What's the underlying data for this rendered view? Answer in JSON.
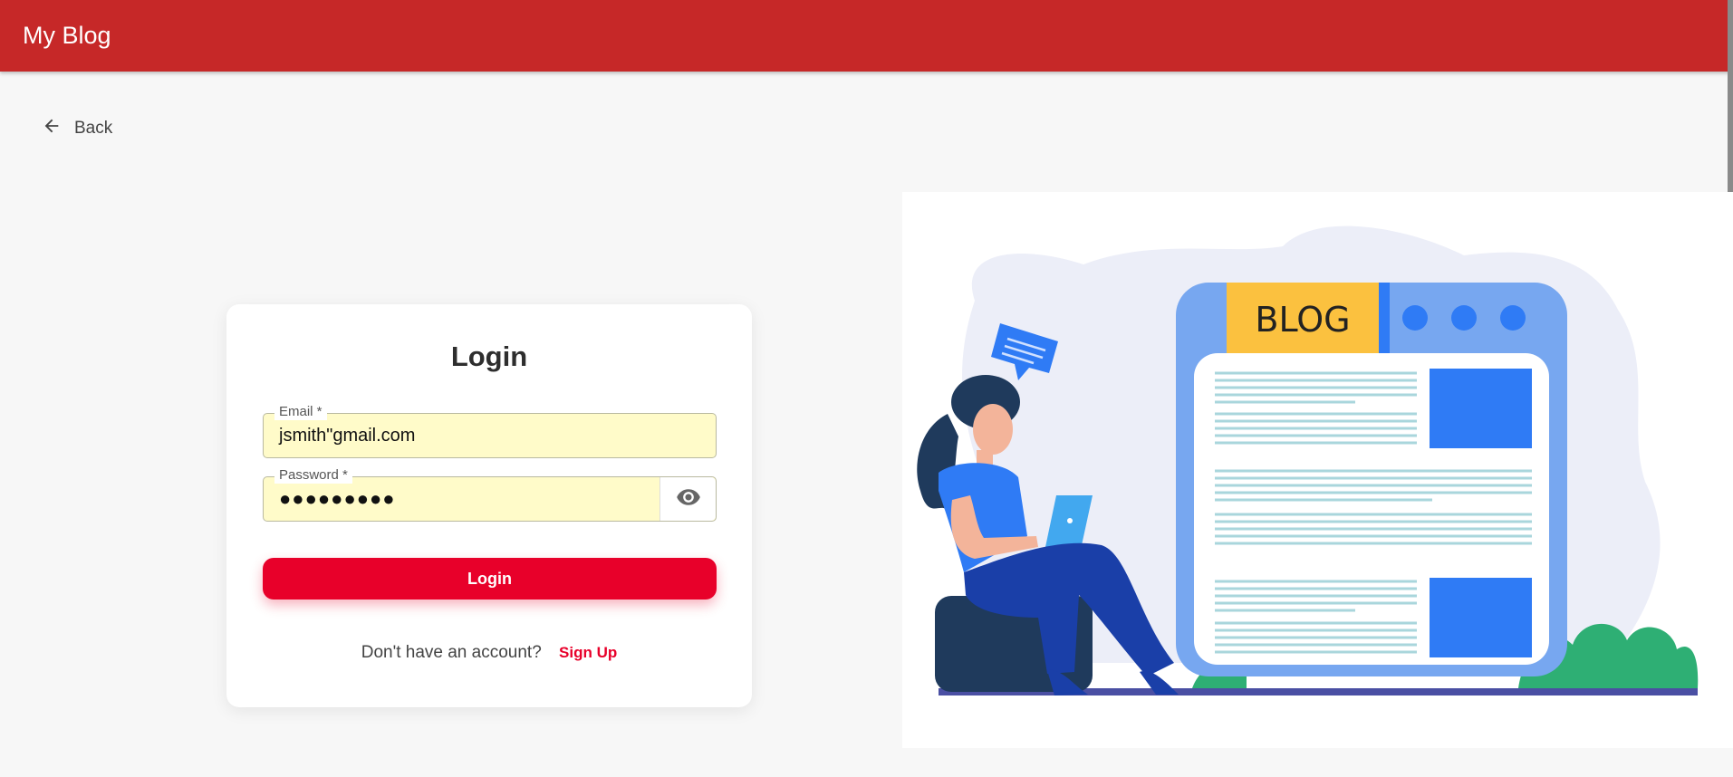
{
  "appbar": {
    "title": "My Blog"
  },
  "nav": {
    "back_label": "Back"
  },
  "login": {
    "title": "Login",
    "email": {
      "label": "Email *",
      "value": "jsmith\"gmail.com"
    },
    "password": {
      "label": "Password *",
      "value": "●●●●●●●●●"
    },
    "submit_label": "Login",
    "signup_prompt": "Don't have an account?",
    "signup_link": "Sign Up"
  },
  "illustration": {
    "sign_text": "BLOG"
  },
  "colors": {
    "appbar": "#c62828",
    "accent": "#e8002a",
    "field_autofill": "#fffbc9",
    "illustration_blue": "#2f7bf5"
  },
  "icons": {
    "back": "arrow-left-icon",
    "password_toggle": "eye-icon"
  }
}
